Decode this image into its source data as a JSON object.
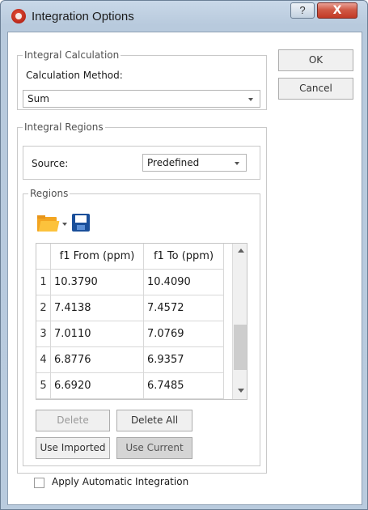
{
  "window": {
    "title": "Integration Options",
    "help_glyph": "?",
    "close_glyph": "X"
  },
  "integral_calculation": {
    "group_label": "Integral Calculation",
    "method_label": "Calculation Method:",
    "method_value": "Sum"
  },
  "buttons": {
    "ok": "OK",
    "cancel": "Cancel",
    "delete": "Delete",
    "delete_all": "Delete All",
    "use_imported": "Use Imported",
    "use_current": "Use Current"
  },
  "integral_regions": {
    "group_label": "Integral Regions",
    "source_label": "Source:",
    "source_value": "Predefined",
    "regions_label": "Regions",
    "toolbar_icons": [
      "folder-open-icon",
      "save-icon"
    ],
    "table": {
      "columns": [
        "f1 From (ppm)",
        "f1 To (ppm)"
      ],
      "rows": [
        {
          "n": "1",
          "from": "10.3790",
          "to": "10.4090"
        },
        {
          "n": "2",
          "from": "7.4138",
          "to": "7.4572"
        },
        {
          "n": "3",
          "from": "7.0110",
          "to": "7.0769"
        },
        {
          "n": "4",
          "from": "6.8776",
          "to": "6.9357"
        },
        {
          "n": "5",
          "from": "6.6920",
          "to": "6.7485"
        }
      ]
    }
  },
  "apply_automatic": {
    "label": "Apply Automatic Integration",
    "checked": false
  },
  "colors": {
    "titlebar": "#b9cbde",
    "close_button": "#c9402c",
    "folder": "#f3a521",
    "save_disk": "#1a4f9a"
  }
}
